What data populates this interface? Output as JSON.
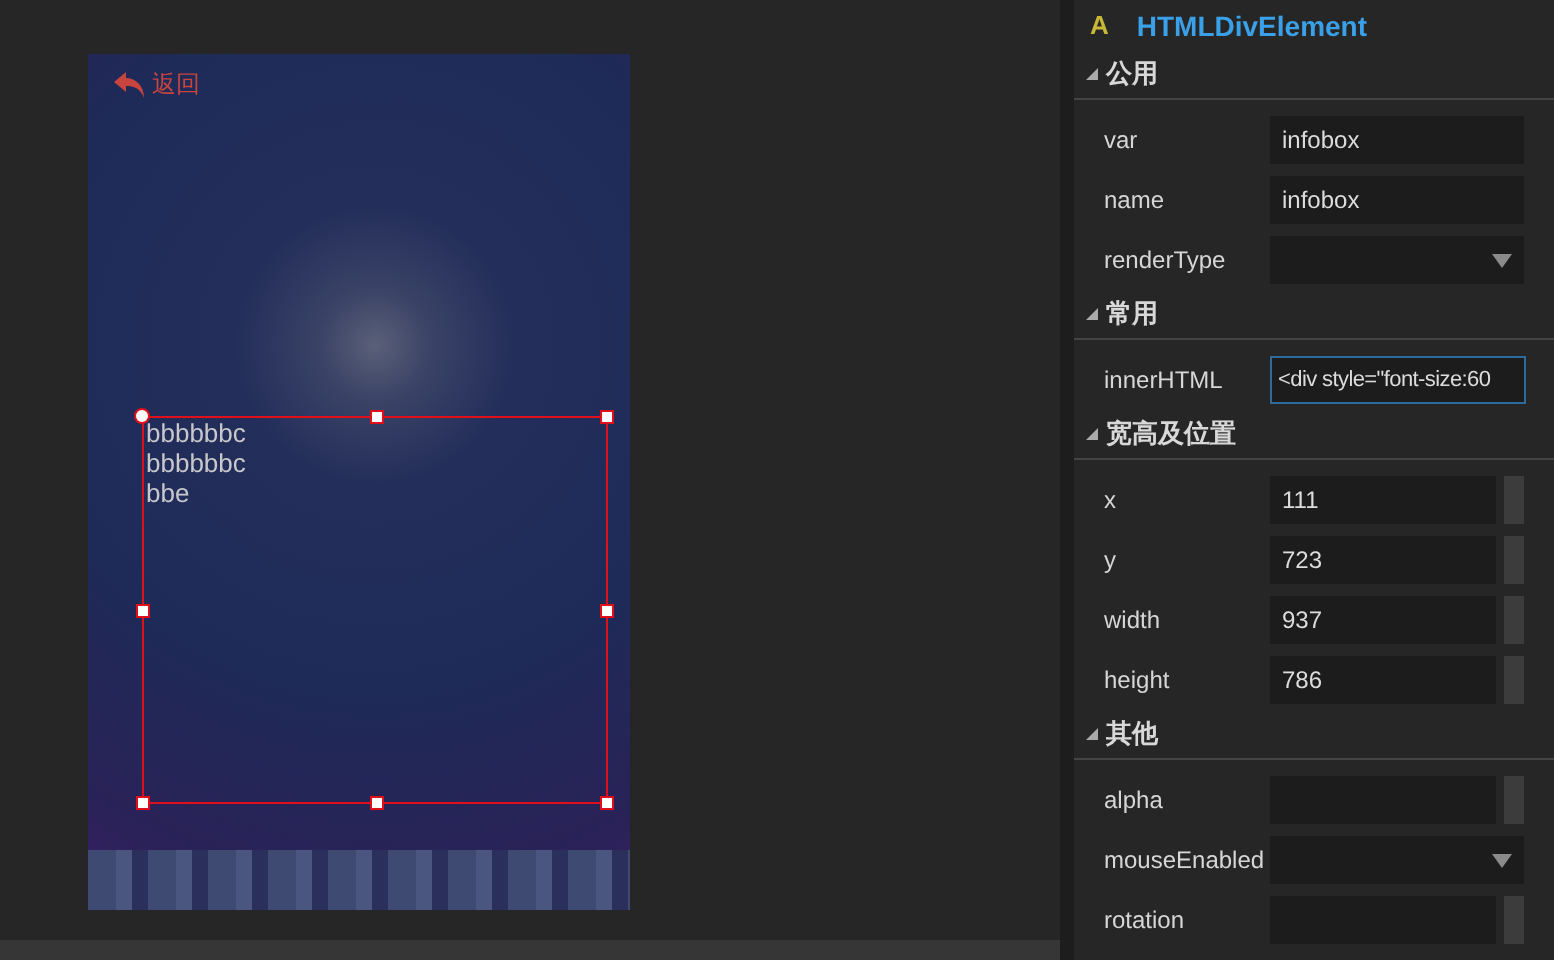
{
  "preview": {
    "back_label": "返回",
    "text_lines": [
      "bbbbbbc",
      "bbbbbbc",
      "bbe"
    ],
    "selected": true
  },
  "inspector": {
    "type_badge": "A",
    "title": "HTMLDivElement",
    "sections": [
      {
        "title": "公用",
        "expanded": true,
        "props": [
          {
            "label": "var",
            "kind": "text",
            "value": "infobox"
          },
          {
            "label": "name",
            "kind": "text",
            "value": "infobox"
          },
          {
            "label": "renderType",
            "kind": "select"
          }
        ]
      },
      {
        "title": "常用",
        "expanded": true,
        "props": [
          {
            "label": "innerHTML",
            "kind": "text",
            "value": "<div style=\"font-size:60",
            "focused": true
          }
        ]
      },
      {
        "title": "宽高及位置",
        "expanded": true,
        "props": [
          {
            "label": "x",
            "kind": "number",
            "value": "111"
          },
          {
            "label": "y",
            "kind": "number",
            "value": "723"
          },
          {
            "label": "width",
            "kind": "number",
            "value": "937"
          },
          {
            "label": "height",
            "kind": "number",
            "value": "786"
          }
        ]
      },
      {
        "title": "其他",
        "expanded": true,
        "props": [
          {
            "label": "alpha",
            "kind": "number"
          },
          {
            "label": "mouseEnabled",
            "kind": "select"
          },
          {
            "label": "rotation",
            "kind": "number"
          }
        ]
      }
    ]
  }
}
